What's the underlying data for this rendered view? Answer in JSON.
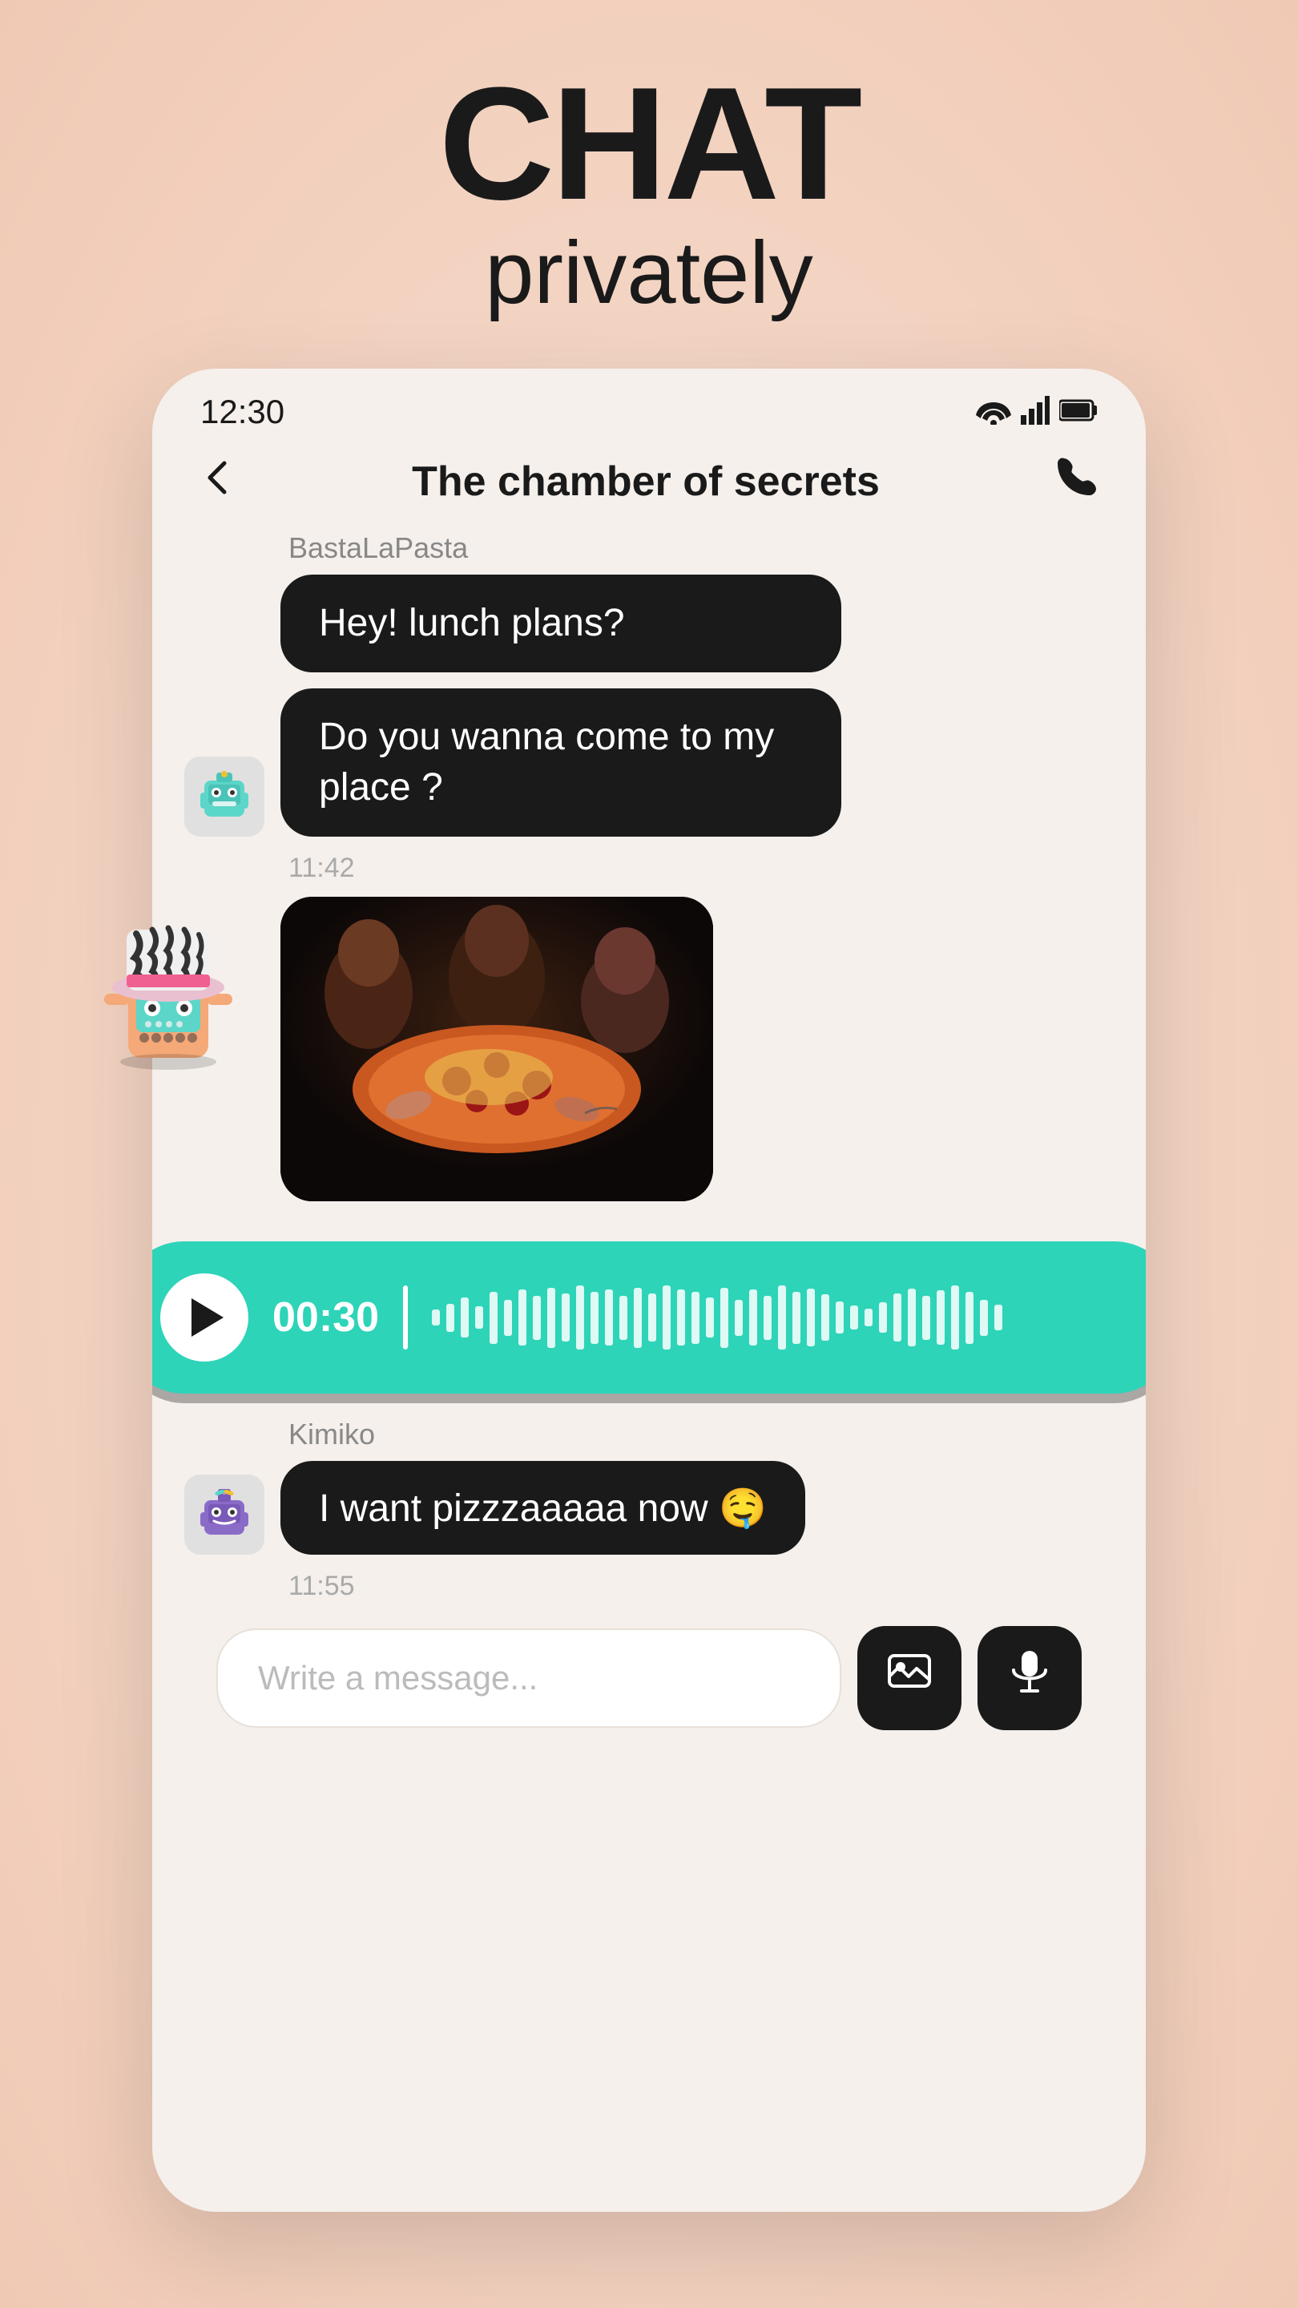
{
  "header": {
    "line1": "CHAT",
    "line2": "privately"
  },
  "status_bar": {
    "time": "12:30",
    "wifi": "▲",
    "signal": "▲",
    "battery": "▮"
  },
  "nav": {
    "back_label": "←",
    "title": "The chamber of secrets",
    "call_icon": "📞"
  },
  "messages": [
    {
      "sender": "BastaLaPasta",
      "has_avatar": true,
      "avatar_type": "robot1",
      "bubbles": [
        "Hey! lunch plans?"
      ],
      "timestamp": null
    },
    {
      "sender": "",
      "has_avatar": true,
      "avatar_type": "robot1",
      "bubbles": [
        "Do you wanna come to my place ?"
      ],
      "timestamp": "11:42"
    }
  ],
  "voice_message": {
    "time": "00:30"
  },
  "kimiko_message": {
    "sender": "Kimiko",
    "text": "I want pizzzaaaaa now 🤤",
    "timestamp": "11:55"
  },
  "input": {
    "placeholder": "Write a message..."
  },
  "buttons": {
    "image_label": "🖼",
    "mic_label": "🎙"
  }
}
